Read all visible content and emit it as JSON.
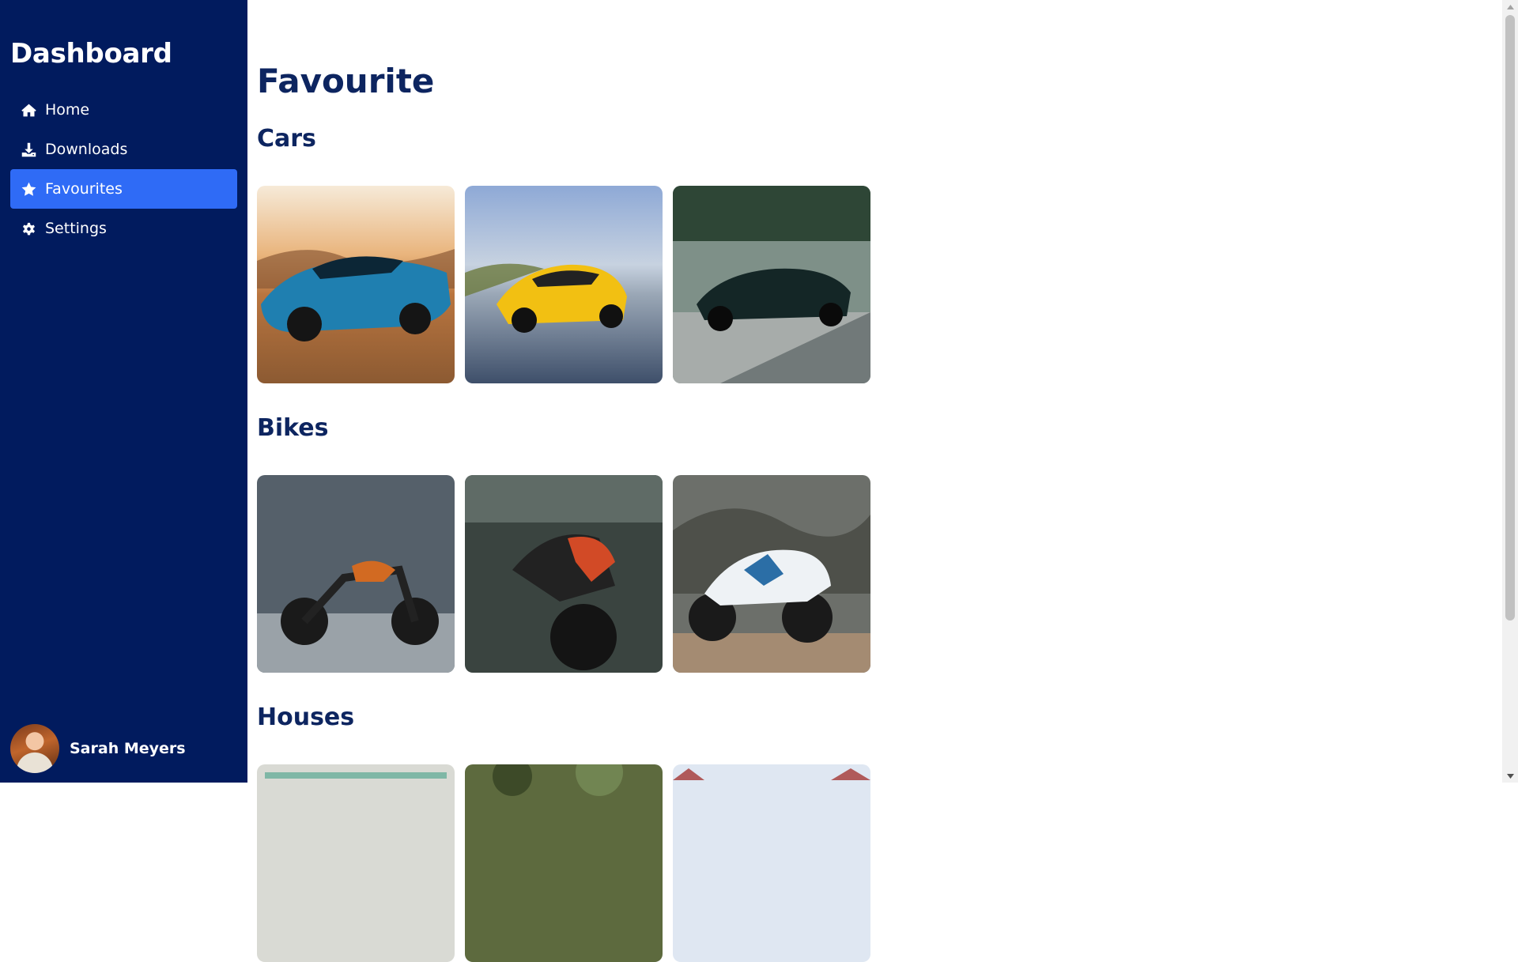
{
  "sidebar": {
    "title": "Dashboard",
    "items": [
      {
        "label": "Home",
        "icon": "home-icon",
        "active": false
      },
      {
        "label": "Downloads",
        "icon": "download-icon",
        "active": false
      },
      {
        "label": "Favourites",
        "icon": "star-icon",
        "active": true
      },
      {
        "label": "Settings",
        "icon": "gear-icon",
        "active": false
      }
    ],
    "profile": {
      "name": "Sarah Meyers",
      "avatar_icon": "avatar"
    }
  },
  "main": {
    "title": "Favourite",
    "sections": [
      {
        "title": "Cars",
        "images": [
          "blue sports car in desert",
          "yellow sports car on road",
          "dark green supercar in parking lot"
        ]
      },
      {
        "title": "Bikes",
        "images": [
          "black and orange electric motorcycle by wall",
          "red motorcycle on street",
          "white and blue sport bike on mountain road"
        ]
      },
      {
        "title": "Houses",
        "images": [
          "house",
          "house",
          "house"
        ]
      }
    ]
  },
  "colors": {
    "sidebar_bg": "#011b5e",
    "active_item": "#2f6bf6",
    "heading": "#0d2560",
    "page_bg": "#ffffff"
  }
}
